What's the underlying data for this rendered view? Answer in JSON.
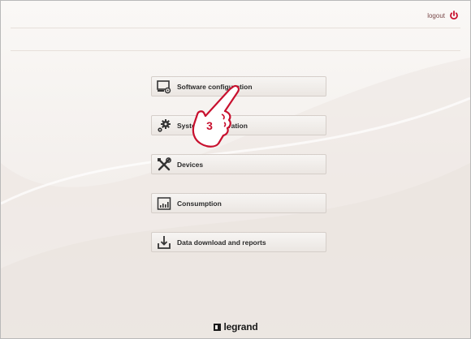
{
  "header": {
    "logout_label": "logout",
    "logout_icon": "power-icon"
  },
  "menu": {
    "items": [
      {
        "label": "Software configuration",
        "icon": "monitor-gear-icon"
      },
      {
        "label": "System configuration",
        "icon": "gears-icon"
      },
      {
        "label": "Devices",
        "icon": "tools-icon"
      },
      {
        "label": "Consumption",
        "icon": "bar-chart-icon"
      },
      {
        "label": "Data download and reports",
        "icon": "download-tray-icon"
      }
    ]
  },
  "callout": {
    "step_number": "3",
    "icon": "pointing-hand-icon"
  },
  "footer": {
    "brand": "legrand"
  },
  "colors": {
    "accent": "#c8102e",
    "text": "#2a2a2a",
    "background": "#f3efec"
  }
}
